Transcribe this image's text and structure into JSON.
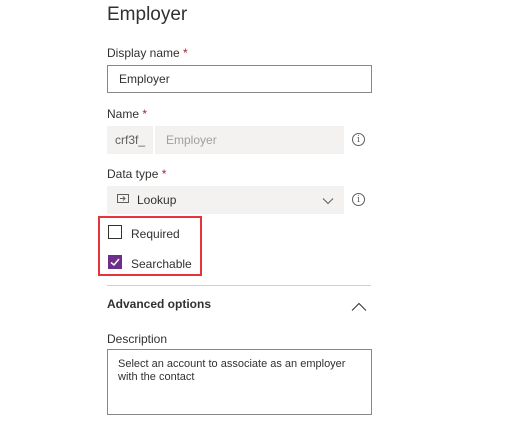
{
  "title": "Employer",
  "display_name": {
    "label": "Display name",
    "required_marker": "*",
    "value": "Employer"
  },
  "name": {
    "label": "Name",
    "required_marker": "*",
    "prefix": "crf3f_",
    "value": "Employer",
    "info_glyph": "i"
  },
  "data_type": {
    "label": "Data type",
    "required_marker": "*",
    "value": "Lookup",
    "icon": "lookup-icon",
    "info_glyph": "i"
  },
  "required": {
    "label": "Required",
    "checked": false
  },
  "searchable": {
    "label": "Searchable",
    "checked": true
  },
  "advanced_options": {
    "label": "Advanced options",
    "expanded": true
  },
  "description": {
    "label": "Description",
    "value": "Select an account to associate as an employer with the contact"
  },
  "colors": {
    "accent": "#6e2f8a",
    "highlight_border": "#e5343a",
    "required": "#a4262c"
  }
}
